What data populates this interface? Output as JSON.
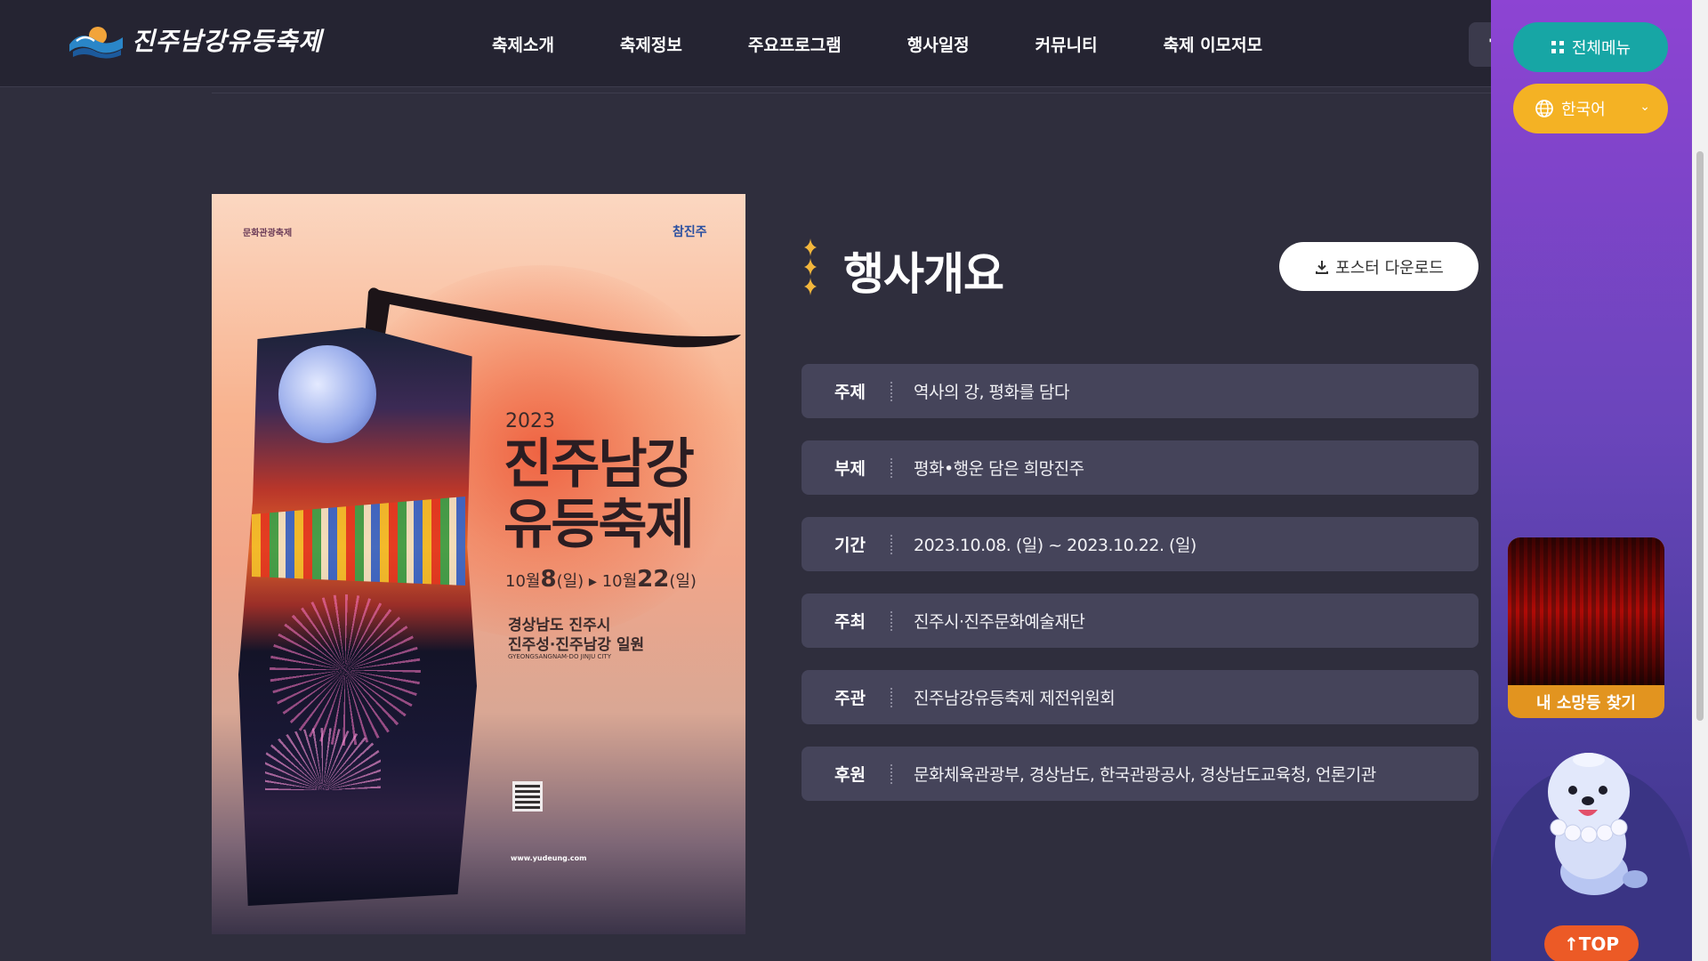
{
  "header": {
    "logo_text": "진주남강유등축제",
    "nav": [
      "축제소개",
      "축제정보",
      "주요프로그램",
      "행사일정",
      "커뮤니티",
      "축제 이모저모"
    ],
    "facebook_letter": "f"
  },
  "poster": {
    "sponsor": "문화관광축제",
    "emblem": "참진주",
    "year": "2023",
    "title_line1": "진주남강",
    "title_line2": "유등축제",
    "date_start_month": "10월",
    "date_start_day": "8",
    "date_start_dow": "(일)",
    "date_end_month": "10월",
    "date_end_day": "22",
    "date_end_dow": "(일)",
    "place_line1": "경상남도 진주시",
    "place_line2": "진주성·진주남강 일원",
    "place_en": "GYEONGSANGNAM-DO JINJU CITY",
    "website": "www.yudeung.com"
  },
  "overview": {
    "title": "행사개요",
    "download_label": "포스터 다운로드",
    "rows": [
      {
        "label": "주제",
        "value": "역사의 강, 평화를 담다"
      },
      {
        "label": "부제",
        "value": "평화•행운 담은 희망진주"
      },
      {
        "label": "기간",
        "value": "2023.10.08. (일) ~ 2023.10.22. (일)"
      },
      {
        "label": "주최",
        "value": "진주시·진주문화예술재단"
      },
      {
        "label": "주관",
        "value": "진주남강유등축제 제전위원회"
      },
      {
        "label": "후원",
        "value": "문화체육관광부, 경상남도, 한국관광공사, 경상남도교육청, 언론기관"
      }
    ]
  },
  "side": {
    "menu_label": "전체메뉴",
    "lang_label": "한국어",
    "wish_label": "내 소망등 찾기",
    "top_label": "TOP"
  },
  "colors": {
    "background": "#2f2e3d",
    "row_bg": "#45445a",
    "menu_btn": "#17a6a5",
    "lang_btn": "#f4b224",
    "top_btn": "#ec5a26",
    "sparkle": "#f3b63c"
  }
}
